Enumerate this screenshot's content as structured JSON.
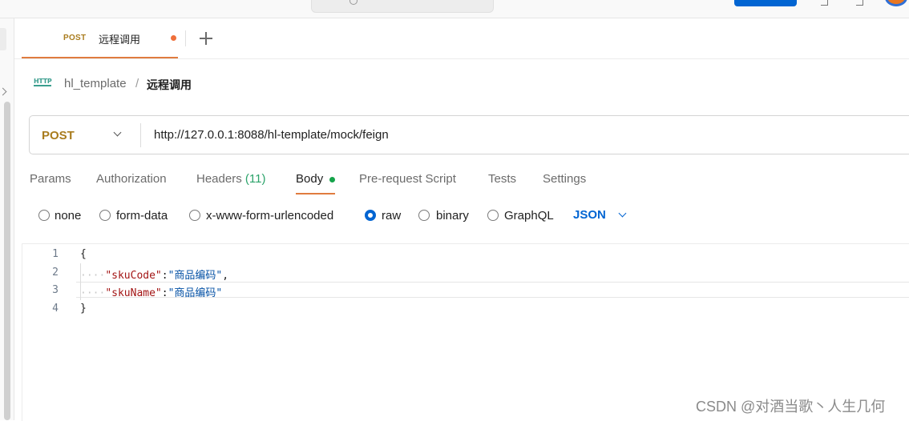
{
  "window": {
    "tab_method": "POST",
    "tab_title": "远程调用"
  },
  "breadcrumb": {
    "collection": "hl_template",
    "separator": "/",
    "current": "远程调用"
  },
  "request": {
    "method": "POST",
    "url": "http://127.0.0.1:8088/hl-template/mock/feign"
  },
  "request_tabs": {
    "params": "Params",
    "authorization": "Authorization",
    "headers": "Headers",
    "headers_count": "(11)",
    "body": "Body",
    "prerequest": "Pre-request Script",
    "tests": "Tests",
    "settings": "Settings",
    "active": "Body"
  },
  "body_modes": {
    "none": "none",
    "form_data": "form-data",
    "urlencoded": "x-www-form-urlencoded",
    "raw": "raw",
    "binary": "binary",
    "graphql": "GraphQL",
    "selected": "raw",
    "language": "JSON"
  },
  "editor": {
    "line_numbers": [
      "1",
      "2",
      "3",
      "4"
    ],
    "open_brace": "{",
    "close_brace": "}",
    "whitespace_marker": "····",
    "lines": [
      {
        "key": "\"skuCode\"",
        "colon": ":",
        "value": "\"商品编码\"",
        "trail": ","
      },
      {
        "key": "\"skuName\"",
        "colon": ":",
        "value": "\"商品编码\"",
        "trail": ""
      }
    ]
  },
  "watermark": "CSDN @对酒当歌丶人生几何",
  "colors": {
    "accent": "#e07c3f",
    "method": "#a97c1e",
    "primary": "#0265d2",
    "green": "#15a34a"
  }
}
